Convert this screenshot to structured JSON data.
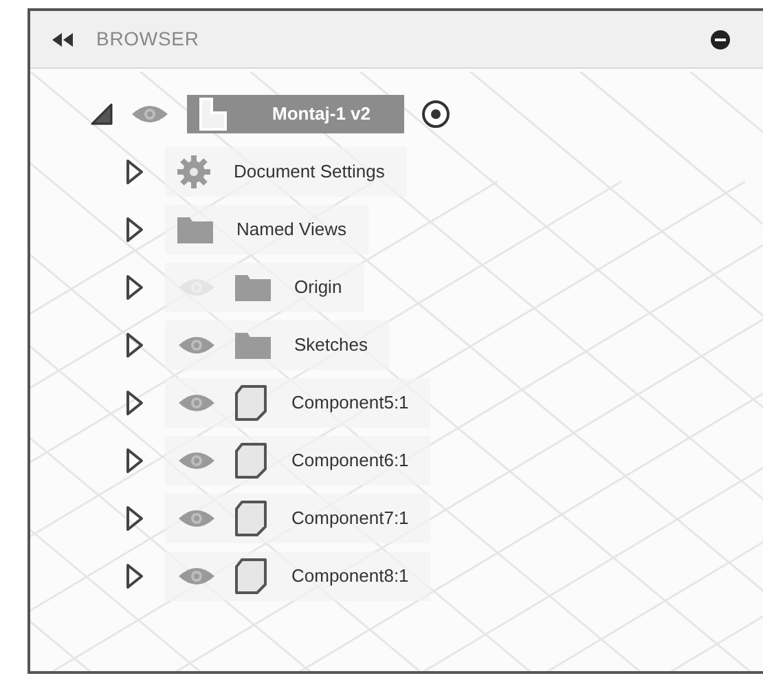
{
  "panel": {
    "title": "BROWSER"
  },
  "tree": [
    {
      "label": "Montaj-1 v2",
      "kind": "document",
      "has_eye": true,
      "visible": true,
      "expanded": true,
      "selected": true,
      "children": [
        {
          "label": "Document Settings",
          "kind": "settings",
          "has_eye": false,
          "expanded": false,
          "selected": false
        },
        {
          "label": "Named Views",
          "kind": "folder",
          "has_eye": false,
          "expanded": false,
          "selected": false
        },
        {
          "label": "Origin",
          "kind": "folder",
          "has_eye": true,
          "visible": false,
          "expanded": false,
          "selected": false
        },
        {
          "label": "Sketches",
          "kind": "folder",
          "has_eye": true,
          "visible": true,
          "expanded": false,
          "selected": false
        },
        {
          "label": "Component5:1",
          "kind": "component",
          "has_eye": true,
          "visible": true,
          "expanded": false,
          "selected": false
        },
        {
          "label": "Component6:1",
          "kind": "component",
          "has_eye": true,
          "visible": true,
          "expanded": false,
          "selected": false
        },
        {
          "label": "Component7:1",
          "kind": "component",
          "has_eye": true,
          "visible": true,
          "expanded": false,
          "selected": false
        },
        {
          "label": "Component8:1",
          "kind": "component",
          "has_eye": true,
          "visible": true,
          "expanded": false,
          "selected": false
        }
      ]
    }
  ]
}
